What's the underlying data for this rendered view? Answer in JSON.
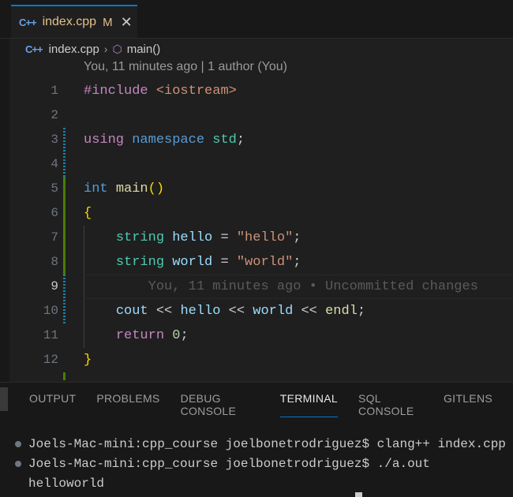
{
  "tab": {
    "icon": "cpp-file-icon",
    "icon_text": "C++",
    "label": "index.cpp",
    "modified": "M",
    "close": "✕"
  },
  "breadcrumb": {
    "file": "index.cpp",
    "sep": "›",
    "symbol": "main()",
    "file_icon_text": "C++",
    "symbol_icon": "⬡"
  },
  "codelens": "You, 11 minutes ago | 1 author (You)",
  "editor": {
    "line_numbers": [
      "1",
      "2",
      "3",
      "4",
      "5",
      "6",
      "7",
      "8",
      "9",
      "10",
      "11",
      "12"
    ],
    "include_kw": "#include",
    "include_file": " <iostream>",
    "using": "using",
    "namespace": "namespace",
    "std": "std",
    "semi": ";",
    "int": "int",
    "main": "main",
    "parens": "()",
    "open_brace": "{",
    "close_brace": "}",
    "string_type": "string",
    "hello_var": "hello",
    "world_var": "world",
    "eq": " = ",
    "hello_str": "\"hello\"",
    "world_str": "\"world\"",
    "blame": "You, 11 minutes ago • Uncommitted changes",
    "cout": "cout",
    "shift": " << ",
    "endl": "endl",
    "return": "return",
    "zero": "0"
  },
  "panel": {
    "tabs": [
      "OUTPUT",
      "PROBLEMS",
      "DEBUG CONSOLE",
      "TERMINAL",
      "SQL CONSOLE",
      "GITLENS"
    ],
    "active_tab": "TERMINAL",
    "terminal": [
      "Joels-Mac-mini:cpp_course joelbonetrodriguez$ clang++ index.cpp",
      "Joels-Mac-mini:cpp_course joelbonetrodriguez$ ./a.out",
      "helloworld"
    ]
  }
}
